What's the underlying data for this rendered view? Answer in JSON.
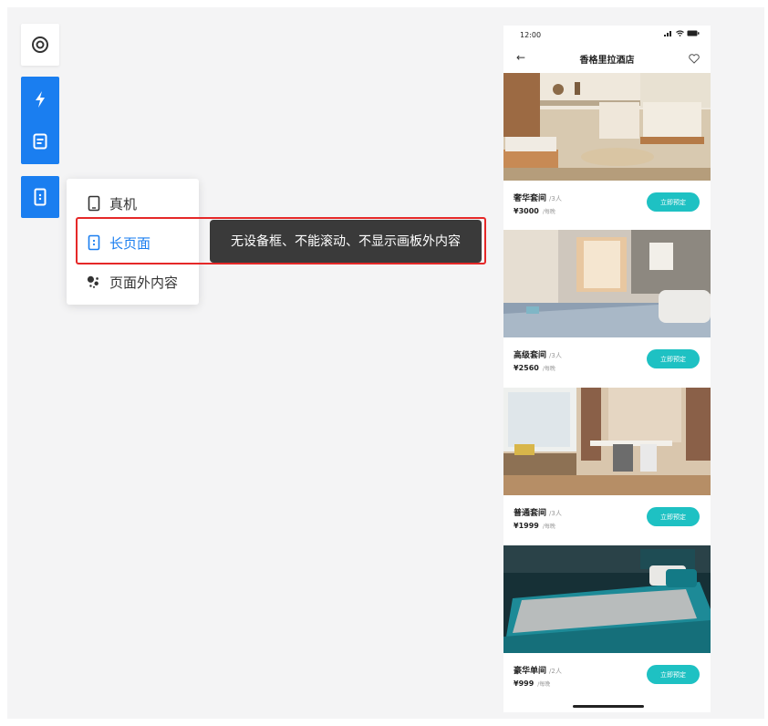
{
  "toolbar": {
    "icons": [
      "target-icon",
      "lightning-icon",
      "document-icon",
      "long-page-icon"
    ]
  },
  "menu": {
    "items": [
      {
        "label": "真机",
        "icon": "phone-outline-icon"
      },
      {
        "label": "长页面",
        "icon": "long-page-icon",
        "selected": true
      },
      {
        "label": "页面外内容",
        "icon": "overflow-dots-icon"
      }
    ]
  },
  "tooltip": {
    "text": "无设备框、不能滚动、不显示画板外内容"
  },
  "phone": {
    "status_time": "12:00",
    "title": "香格里拉酒店",
    "rooms": [
      {
        "name": "奢华套间",
        "capacity": "/3人",
        "price": "¥3000",
        "unit": "/每晚",
        "button": "立即预定"
      },
      {
        "name": "高级套间",
        "capacity": "/3人",
        "price": "¥2560",
        "unit": "/每晚",
        "button": "立即预定"
      },
      {
        "name": "普通套间",
        "capacity": "/3人",
        "price": "¥1999",
        "unit": "/每晚",
        "button": "立即预定"
      },
      {
        "name": "豪华单间",
        "capacity": "/2人",
        "price": "¥999",
        "unit": "/每晚",
        "button": "立即预定"
      }
    ]
  },
  "colors": {
    "accent": "#1a7ef0",
    "highlight": "#e52828",
    "tooltip_bg": "#3a3a3a",
    "book_button": "#1ec1c3"
  }
}
